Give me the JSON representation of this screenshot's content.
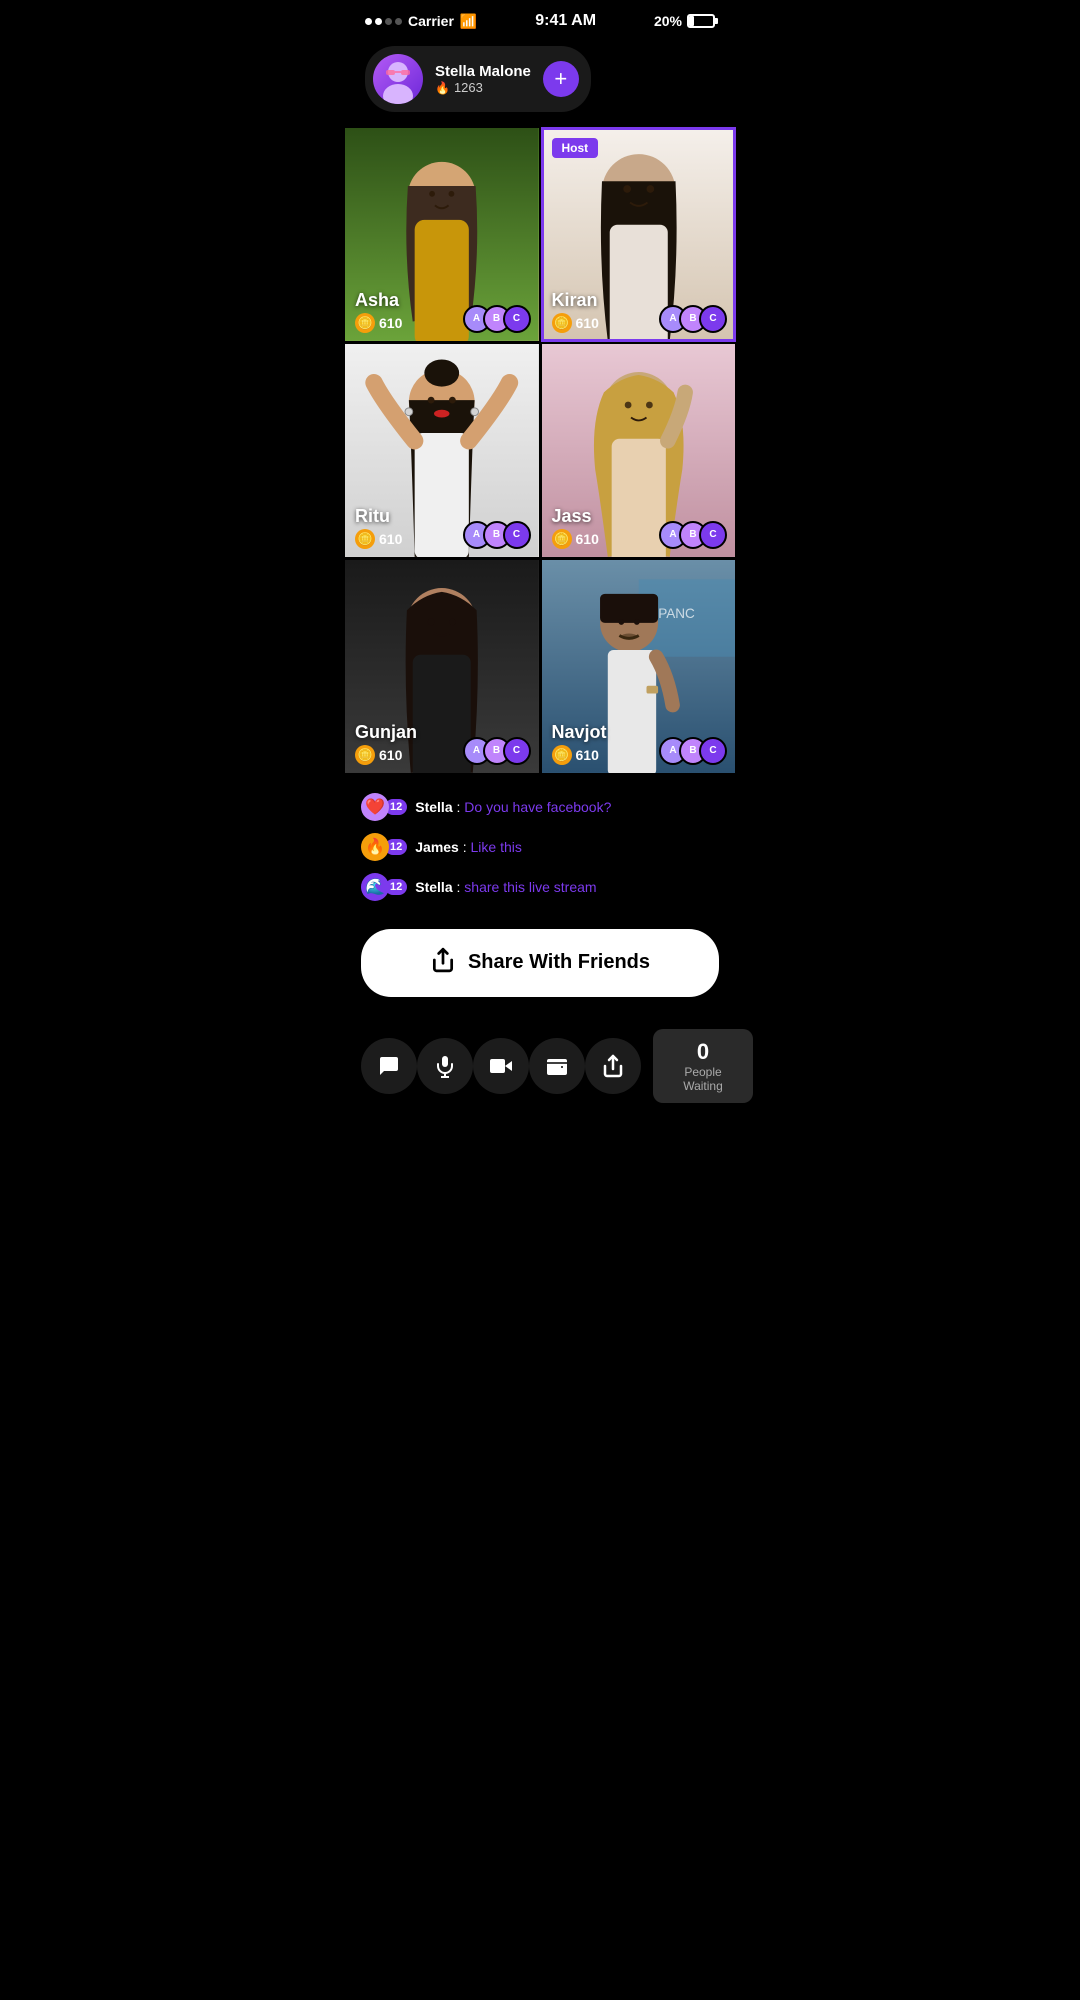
{
  "statusBar": {
    "carrier": "Carrier",
    "time": "9:41 AM",
    "battery": "20%"
  },
  "profile": {
    "name": "Stella Malone",
    "score": "1263",
    "addButtonLabel": "+"
  },
  "grid": {
    "cells": [
      {
        "id": "asha",
        "name": "Asha",
        "coins": "610",
        "isHost": false,
        "bgClass": "bg-asha",
        "color1": "#2d5016",
        "color2": "#6ba33a"
      },
      {
        "id": "kiran",
        "name": "Kiran",
        "coins": "610",
        "isHost": true,
        "bgClass": "bg-kiran",
        "color1": "#e8d0c0",
        "color2": "#f5ede0"
      },
      {
        "id": "ritu",
        "name": "Ritu",
        "coins": "610",
        "isHost": false,
        "bgClass": "bg-ritu",
        "color1": "#e0e0e0",
        "color2": "#f0f0f0"
      },
      {
        "id": "jass",
        "name": "Jass",
        "coins": "610",
        "isHost": false,
        "bgClass": "bg-jass",
        "color1": "#d4a0b0",
        "color2": "#e8c8d4"
      },
      {
        "id": "gunjan",
        "name": "Gunjan",
        "coins": "610",
        "isHost": false,
        "bgClass": "bg-gunjan",
        "color1": "#1a1a1a",
        "color2": "#3a3a3a"
      },
      {
        "id": "navjot",
        "name": "Navjot",
        "coins": "610",
        "isHost": false,
        "bgClass": "bg-navjot",
        "color1": "#4a7090",
        "color2": "#6a8fa8"
      }
    ],
    "hostLabel": "Host"
  },
  "chat": {
    "messages": [
      {
        "user": "Stella",
        "level": "12",
        "text": "Do you have facebook?",
        "avatarEmoji": "❤️",
        "avatarBg": "#c084fc"
      },
      {
        "user": "James",
        "level": "12",
        "text": "Like this",
        "avatarEmoji": "🔥",
        "avatarBg": "#f59e0b"
      },
      {
        "user": "Stella",
        "level": "12",
        "text": "share this live stream",
        "avatarEmoji": "🌊",
        "avatarBg": "#7c3aed"
      }
    ]
  },
  "shareButton": {
    "label": "Share With Friends"
  },
  "bottomBar": {
    "peopleCount": "0",
    "peopleLabel": "People Waiting",
    "actions": [
      {
        "id": "chat",
        "icon": "💬"
      },
      {
        "id": "mic",
        "icon": "🎤"
      },
      {
        "id": "video",
        "icon": "📹"
      },
      {
        "id": "wallet",
        "icon": "👛"
      },
      {
        "id": "share",
        "icon": "↗"
      }
    ]
  },
  "miniAvatars": [
    {
      "initials": "A",
      "color": "#a78bfa"
    },
    {
      "initials": "B",
      "color": "#c084fc"
    },
    {
      "initials": "C",
      "color": "#7c3aed"
    }
  ]
}
